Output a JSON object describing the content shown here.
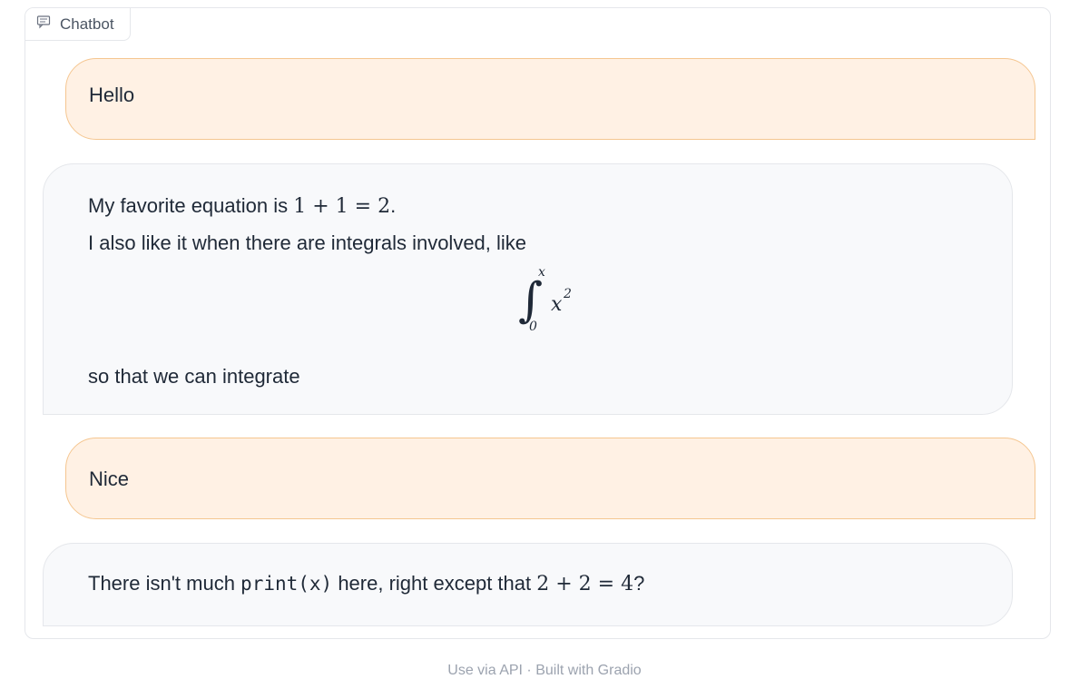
{
  "panel": {
    "label": "Chatbot",
    "label_icon": "chat-bubble-icon"
  },
  "messages": [
    {
      "role": "user",
      "text": "Hello"
    },
    {
      "role": "bot",
      "line1_prefix": "My favorite equation is ",
      "line1_math": "1 + 1 = 2",
      "line1_suffix": ".",
      "line2": "I also like it when there are integrals involved, like",
      "integral": {
        "lower": "0",
        "upper": "x",
        "integrand": "x",
        "exponent": "2"
      },
      "line3": "so that we can integrate"
    },
    {
      "role": "user",
      "text": "Nice"
    },
    {
      "role": "bot",
      "prefix": "There isn't much ",
      "code": "print(x)",
      "middle": " here, right except that ",
      "math": "2 + 2 = 4",
      "suffix": "?"
    }
  ],
  "footer": {
    "text": "Use via API  ·  Built with Gradio"
  },
  "colors": {
    "user_bubble_bg": "#fff1e4",
    "user_bubble_border": "#f5c690",
    "bot_bubble_bg": "#f8f9fb",
    "bot_bubble_border": "#e5e7eb"
  }
}
